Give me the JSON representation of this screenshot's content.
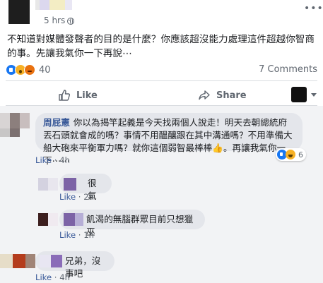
{
  "post": {
    "timestamp": "5 hrs · ",
    "text": "不知道對媒體發聲者的目的是什麼？你應該超沒能力處理這件超越你智商的事。先讓我氣你一下再說⋯",
    "more_icon": "more-horizontal-icon",
    "privacy_icon": "globe-icon"
  },
  "reactions": {
    "icons": [
      "like-icon",
      "wow-icon",
      "angry-icon"
    ],
    "count": "40",
    "comments": "7 Comments"
  },
  "actions": {
    "like": "Like",
    "share": "Share"
  },
  "colors": {
    "link": "#385898",
    "meta": "#606770",
    "bubble": "#e4e6eb",
    "comments_bg": "#f2f3f5",
    "like_blue": "#1877f2"
  },
  "comments": [
    {
      "author": "周屁憲",
      "text": "你以為揭竿起義是今天找兩個人說走！明天去朝總統府丟石頭就會成的嗎？事情不用醞釀跟在其中溝通嗎？不用準備大船大砲來平衡軍力嗎？就你這個弱智最棒棒👍。再讓我氣你一下⋯⋯",
      "like": "Like",
      "time": "4h",
      "reaction_count": "6"
    },
    {
      "text": "很氣",
      "like": "Like",
      "time": "2h"
    },
    {
      "text": "飢渴的無腦群眾目前只想獵巫",
      "like": "Like",
      "time": "1h"
    },
    {
      "text": "兄弟，沒事吧",
      "like": "Like",
      "time": "4h"
    }
  ]
}
